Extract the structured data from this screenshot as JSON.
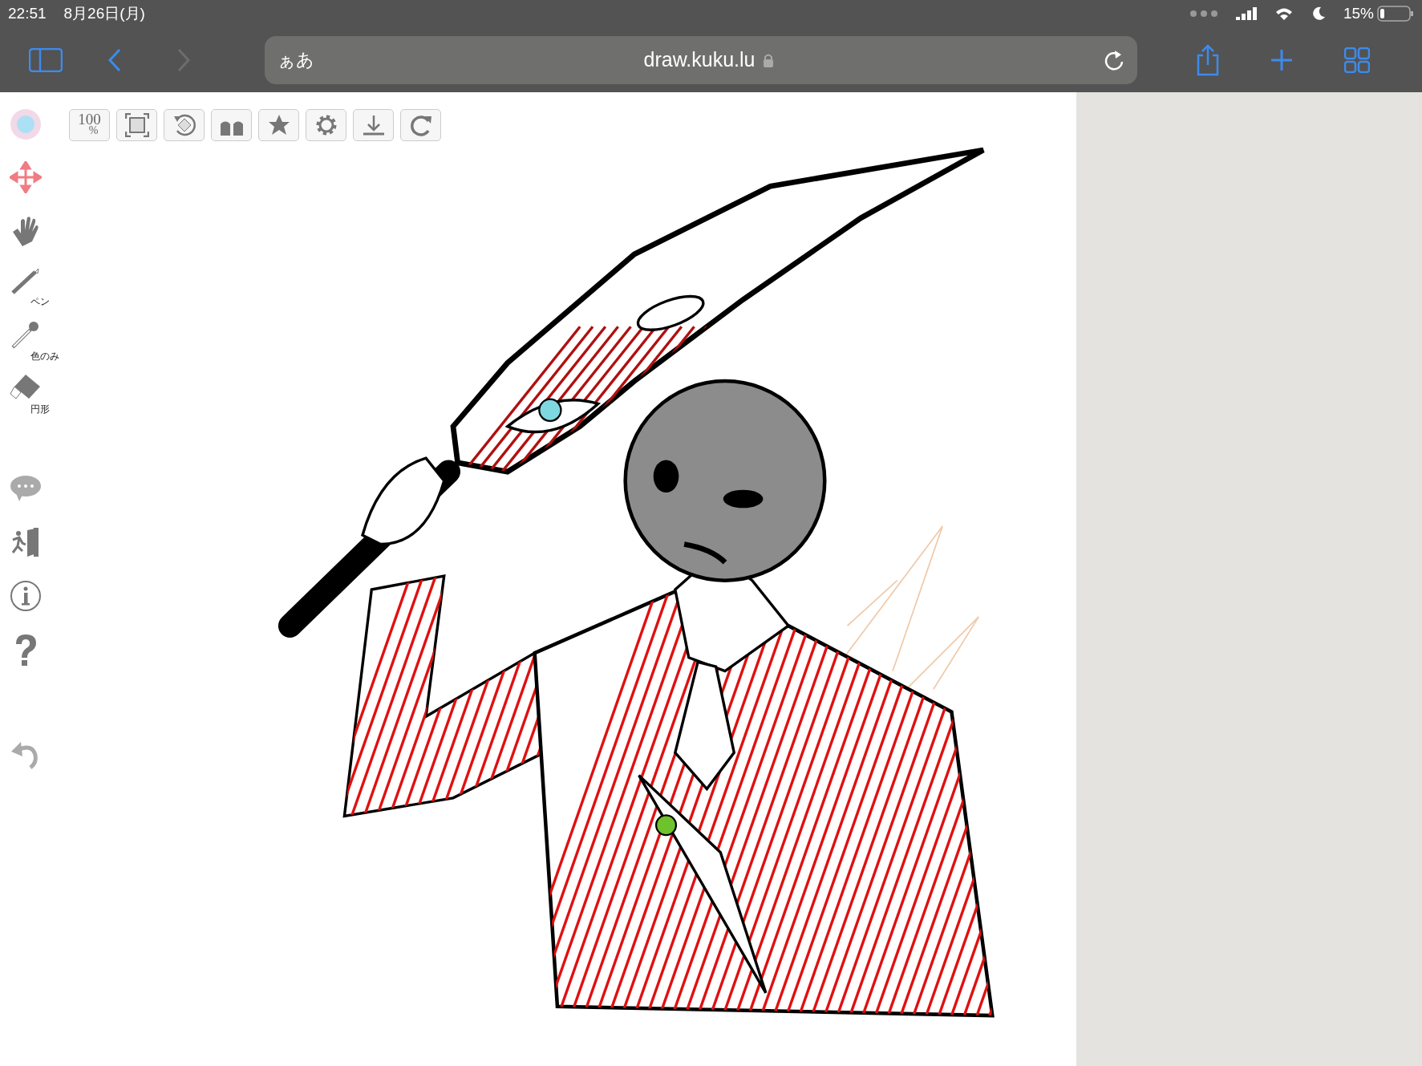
{
  "status_bar": {
    "time": "22:51",
    "date": "8月26日(月)",
    "battery": "15%"
  },
  "browser_toolbar": {
    "text_size_button": "ぁあ",
    "url": "draw.kuku.lu",
    "forward_disabled": true
  },
  "canvas_toolbar": {
    "zoom_label": "100",
    "zoom_unit": "%"
  },
  "tools": [
    {
      "kind": "color"
    },
    {
      "kind": "move"
    },
    {
      "kind": "hand"
    },
    {
      "kind": "pen",
      "label": "ペン"
    },
    {
      "kind": "eyedropper",
      "label": "色のみ"
    },
    {
      "kind": "eraser",
      "label": "円形"
    },
    {
      "kind": "chat"
    },
    {
      "kind": "exit"
    },
    {
      "kind": "info"
    },
    {
      "kind": "help"
    },
    {
      "kind": "undo"
    }
  ]
}
